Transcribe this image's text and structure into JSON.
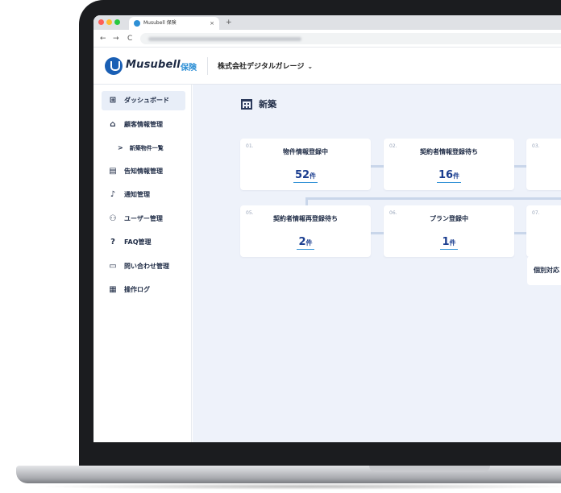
{
  "browser": {
    "tab_title": "Musubell 保険",
    "tab_close": "×",
    "new_tab": "+",
    "back": "←",
    "forward": "→",
    "reload": "C",
    "site_info": "⇅"
  },
  "header": {
    "logo_text": "Musubell",
    "logo_sub": "保険",
    "company": "株式会社デジタルガレージ",
    "company_chevron": "⌄"
  },
  "sidebar": {
    "items": [
      {
        "label": "ダッシュボード",
        "icon": "dashboard-icon",
        "glyph": "⊞"
      },
      {
        "label": "顧客情報管理",
        "icon": "home-icon",
        "glyph": "⌂"
      },
      {
        "label": "告知情報管理",
        "icon": "document-icon",
        "glyph": "▤"
      },
      {
        "label": "通知管理",
        "icon": "bell-icon",
        "glyph": "♪"
      },
      {
        "label": "ユーザー管理",
        "icon": "users-icon",
        "glyph": "⚇"
      },
      {
        "label": "FAQ管理",
        "icon": "question-icon",
        "glyph": "?"
      },
      {
        "label": "問い合わせ管理",
        "icon": "chat-icon",
        "glyph": "▭"
      },
      {
        "label": "操作ログ",
        "icon": "log-icon",
        "glyph": "▦"
      }
    ],
    "sub_item": {
      "label": "新築物件一覧",
      "chevron": ">"
    }
  },
  "main": {
    "title": "新築",
    "cards": [
      {
        "num": "01.",
        "label": "物件情報登録中",
        "value": "52",
        "unit": "件"
      },
      {
        "num": "02.",
        "label": "契約者情報登録待ち",
        "value": "16",
        "unit": "件"
      },
      {
        "num": "03.",
        "label": "",
        "value": "",
        "unit": ""
      },
      {
        "num": "05.",
        "label": "契約者情報再登録待ち",
        "value": "2",
        "unit": "件"
      },
      {
        "num": "06.",
        "label": "プラン登録中",
        "value": "1",
        "unit": "件"
      },
      {
        "num": "07.",
        "label": "",
        "value": "",
        "unit": ""
      }
    ],
    "partial_card_label": "個別対応"
  },
  "colors": {
    "accent": "#2d8fd5",
    "navy": "#1d2a44",
    "main_bg": "#eef2fa",
    "active_item_bg": "#e8eef8"
  }
}
